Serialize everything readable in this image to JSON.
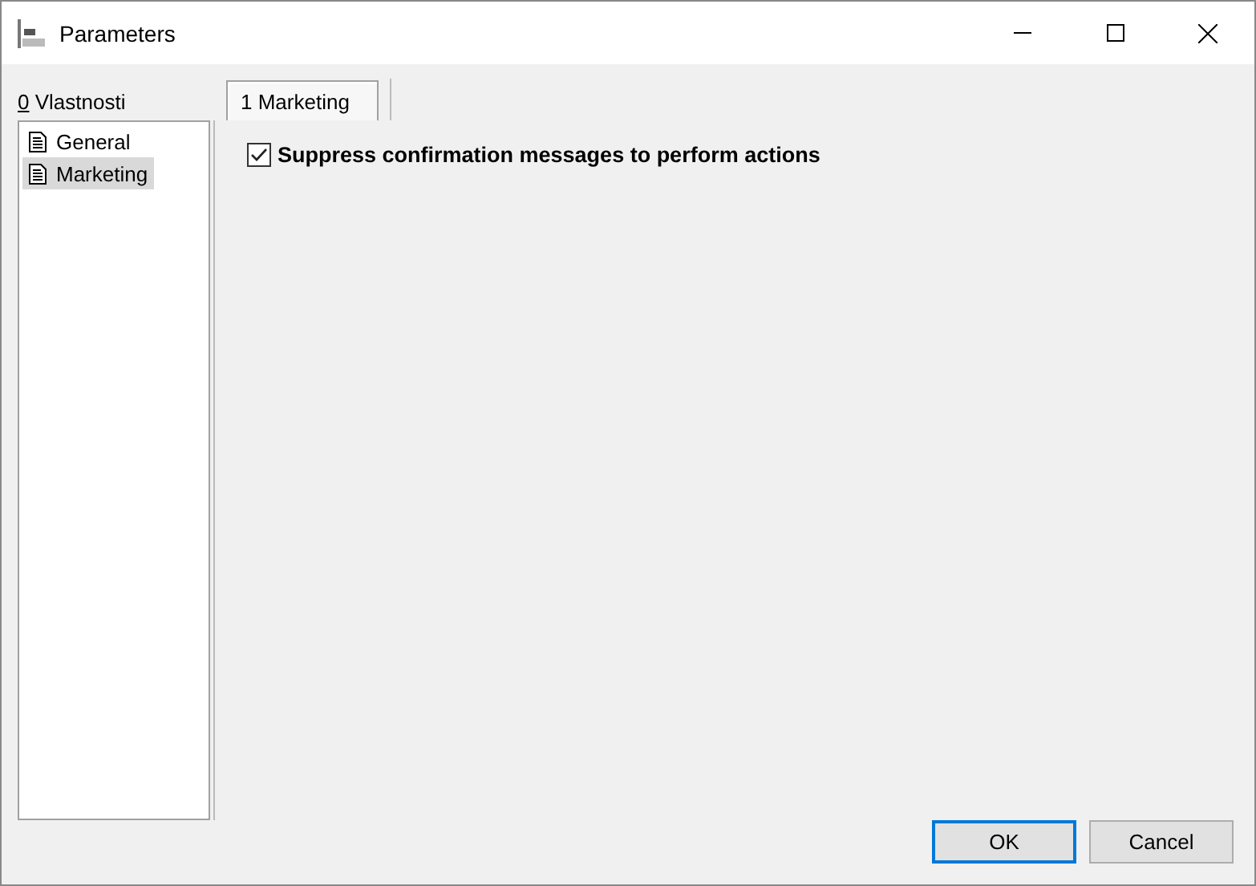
{
  "window": {
    "title": "Parameters"
  },
  "sidebar": {
    "label": "0 Vlastnosti",
    "items": [
      {
        "label": "General",
        "selected": false
      },
      {
        "label": "Marketing",
        "selected": true
      }
    ]
  },
  "tabs": [
    {
      "label": "1 Marketing",
      "selected": true
    }
  ],
  "options": [
    {
      "label": "Suppress confirmation messages to perform actions",
      "checked": true
    }
  ],
  "buttons": [
    {
      "label": "OK",
      "default": true
    },
    {
      "label": "Cancel",
      "default": false
    }
  ]
}
